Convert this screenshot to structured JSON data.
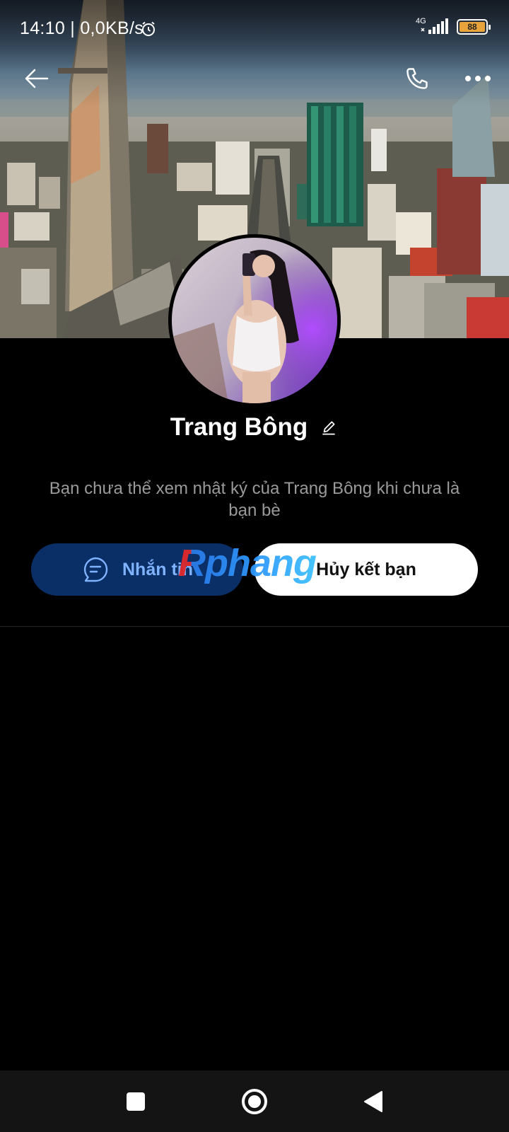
{
  "status_bar": {
    "time": "14:10 | 0,0KB/s",
    "network": "4G",
    "battery": "88",
    "alarm_icon": "alarm-clock-icon",
    "signal_icon": "signal-bars-icon"
  },
  "header": {
    "back_icon": "arrow-left-icon",
    "call_icon": "phone-icon",
    "more_icon": "more-dots-icon"
  },
  "profile": {
    "name": "Trang Bông",
    "edit_icon": "pencil-icon",
    "info": "Bạn chưa thể xem nhật ký của Trang Bông khi chưa là bạn bè"
  },
  "actions": {
    "message_label": "Nhắn tin",
    "message_icon": "chat-bubble-icon",
    "unfriend_label": "Hủy kết bạn"
  },
  "watermark": {
    "text": "Rphang"
  },
  "nav": {
    "recent_icon": "square-icon",
    "home_icon": "circle-icon",
    "back_icon": "triangle-back-icon"
  },
  "colors": {
    "message_button_bg": "#0a2f66",
    "message_button_text": "#7fb2ff",
    "unfriend_button_bg": "#ffffff",
    "background": "#000000",
    "info_text": "#9a9a9a"
  }
}
